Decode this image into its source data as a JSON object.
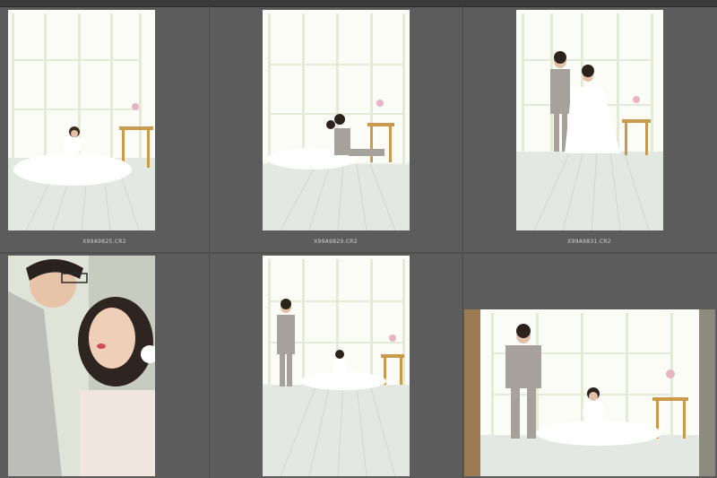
{
  "filmstrip": {
    "row1": [
      {
        "filename": "X99A9825.CR2"
      },
      {
        "filename": "X99A9829.CR2"
      },
      {
        "filename": "X99A9831.CR2"
      }
    ]
  },
  "colors": {
    "panel_bg": "#5c5c5c",
    "grid_line": "#4a4a4a",
    "caption_text": "#d0d0d0"
  }
}
